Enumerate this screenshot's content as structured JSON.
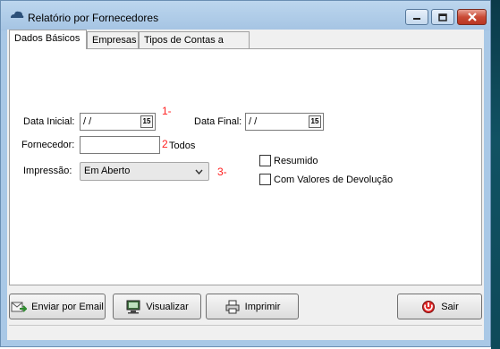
{
  "window": {
    "title": "Relatório por Fornecedores"
  },
  "tabs": [
    {
      "label": "Dados Básicos"
    },
    {
      "label": "Empresas"
    },
    {
      "label": "Tipos de Contas a Pagar"
    }
  ],
  "form": {
    "data_inicial_label": "Data Inicial:",
    "data_inicial_value": " / /",
    "data_final_label": "Data Final:",
    "data_final_value": " / /",
    "date_btn_glyph": "15",
    "fornecedor_label": "Fornecedor:",
    "fornecedor_value": "",
    "todos_label": "Todos",
    "impressao_label": "Impressão:",
    "impressao_value": "Em Aberto",
    "resumido_label": "Resumido",
    "com_valores_label": "Com Valores de Devolução",
    "annotations": [
      "1-",
      "2",
      "3-"
    ]
  },
  "buttons": {
    "enviar_email": "Enviar por  Email",
    "visualizar": "Visualizar",
    "imprimir": "Imprimir",
    "sair": "Sair"
  },
  "icons": {
    "app": "cloud-icon",
    "minimize": "minimize-icon",
    "maximize": "maximize-icon",
    "close": "close-icon",
    "email": "email-send-icon",
    "monitor": "monitor-icon",
    "printer": "printer-icon",
    "exit": "exit-icon"
  }
}
